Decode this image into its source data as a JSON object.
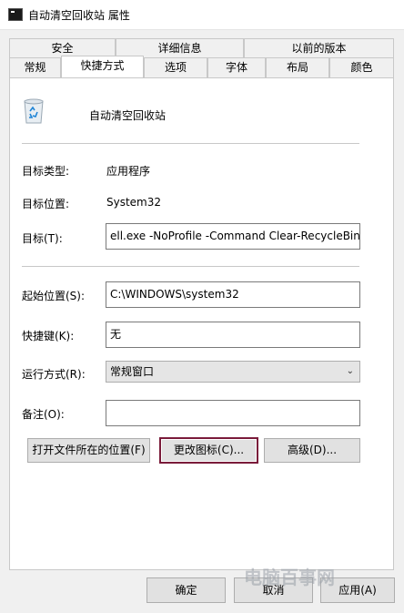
{
  "window": {
    "title": "自动清空回收站 属性"
  },
  "tabs_top": [
    "安全",
    "详细信息",
    "以前的版本"
  ],
  "tabs_bottom": [
    "常规",
    "快捷方式",
    "选项",
    "字体",
    "布局",
    "颜色"
  ],
  "active_tab": "快捷方式",
  "shortcut": {
    "name": "自动清空回收站",
    "target_type_label": "目标类型:",
    "target_type_value": "应用程序",
    "target_location_label": "目标位置:",
    "target_location_value": "System32",
    "target_label": "目标(T):",
    "target_value": "ell.exe -NoProfile -Command Clear-RecycleBin\"",
    "start_in_label": "起始位置(S):",
    "start_in_value": "C:\\WINDOWS\\system32",
    "hotkey_label": "快捷键(K):",
    "hotkey_value": "无",
    "run_label": "运行方式(R):",
    "run_value": "常规窗口",
    "comment_label": "备注(O):",
    "comment_value": ""
  },
  "buttons": {
    "open_location": "打开文件所在的位置(F)",
    "change_icon": "更改图标(C)...",
    "advanced": "高级(D)...",
    "ok": "确定",
    "cancel": "取消",
    "apply": "应用(A)"
  },
  "watermark": "电脑百事网"
}
